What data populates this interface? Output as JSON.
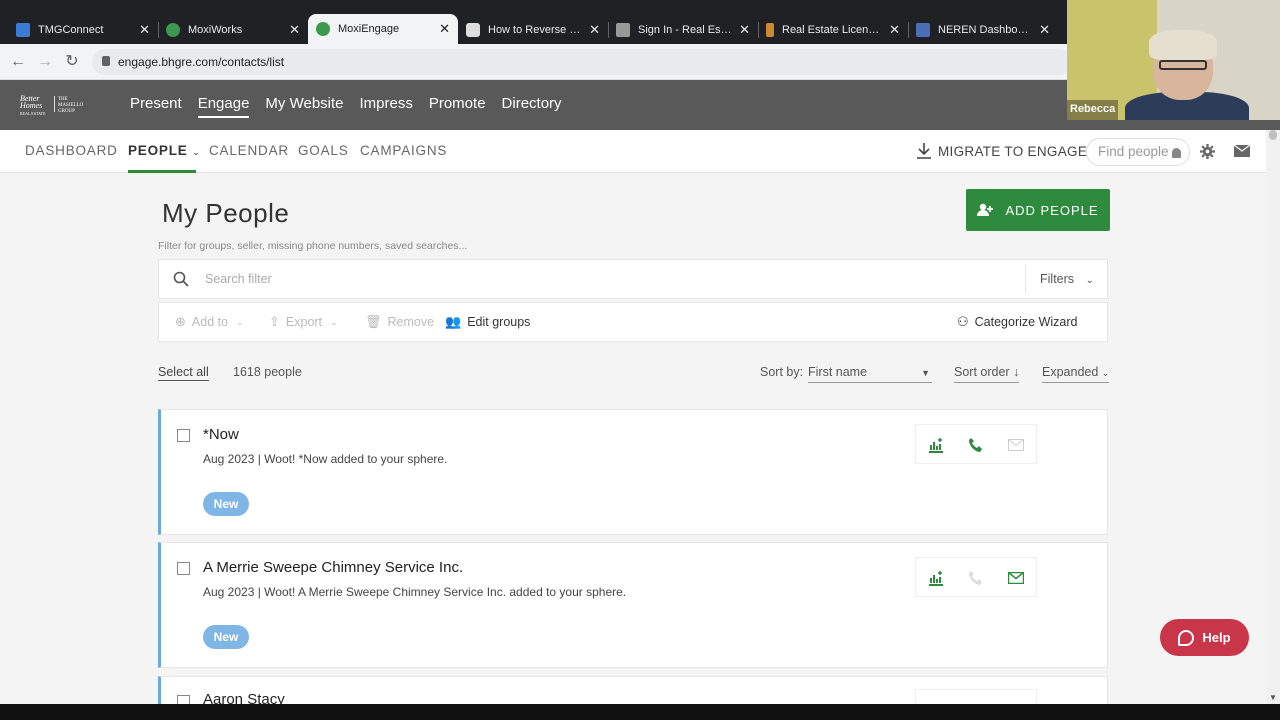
{
  "browser": {
    "tabs": [
      {
        "title": "TMGConnect",
        "favicon_color": "#3a7bd5"
      },
      {
        "title": "MoxiWorks",
        "favicon_color": "#3c9a4e"
      },
      {
        "title": "MoxiEngage",
        "favicon_color": "#3c9a4e"
      },
      {
        "title": "How to Reverse your",
        "favicon_color": "#dddddd"
      },
      {
        "title": "Sign In - Real Estate",
        "favicon_color": "#999999"
      },
      {
        "title": "Real Estate Licensing",
        "favicon_color": "#cc8833"
      },
      {
        "title": "NEREN Dashboard",
        "favicon_color": "#4a6fb5"
      }
    ],
    "url": "engage.bhgre.com/contacts/list"
  },
  "header": {
    "logo_line1": "Better",
    "logo_line2": "Homes",
    "logo_line3": "REAL ESTATE",
    "logo_right1": "THE",
    "logo_right2": "MASIELLO",
    "logo_right3": "GROUP",
    "nav": [
      "Present",
      "Engage",
      "My Website",
      "Impress",
      "Promote",
      "Directory"
    ]
  },
  "subnav": {
    "items": [
      "DASHBOARD",
      "PEOPLE",
      "CALENDAR",
      "GOALS",
      "CAMPAIGNS"
    ],
    "migrate": "MIGRATE TO ENGAGE",
    "find_placeholder": "Find people"
  },
  "page": {
    "title": "My People",
    "subtitle": "Filter for groups, seller, missing phone numbers, saved searches...",
    "add_people": "ADD PEOPLE",
    "search_placeholder": "Search filter",
    "filters": "Filters"
  },
  "toolbar": {
    "add_to": "Add to",
    "export": "Export",
    "remove": "Remove",
    "edit_groups": "Edit groups",
    "categorize": "Categorize Wizard"
  },
  "listmeta": {
    "select_all": "Select all",
    "count": "1618 people",
    "sort_by_label": "Sort by:",
    "sort_by_value": "First name",
    "sort_order": "Sort order",
    "expanded": "Expanded"
  },
  "contacts": [
    {
      "name": "*Now",
      "meta": "Aug 2023 | Woot! *Now added to your sphere.",
      "badge": "New"
    },
    {
      "name": "A Merrie Sweepe Chimney Service Inc.",
      "meta": "Aug 2023 | Woot! A Merrie Sweepe Chimney Service Inc. added to your sphere.",
      "badge": "New"
    },
    {
      "name": "Aaron Stacy",
      "meta": "",
      "badge": ""
    }
  ],
  "help": "Help",
  "video": {
    "name": "Rebecca"
  },
  "colors": {
    "brand_green": "#2e8b3d",
    "header_gray": "#595959",
    "badge_blue": "#7fb6e6",
    "help_red": "#c9364a"
  }
}
